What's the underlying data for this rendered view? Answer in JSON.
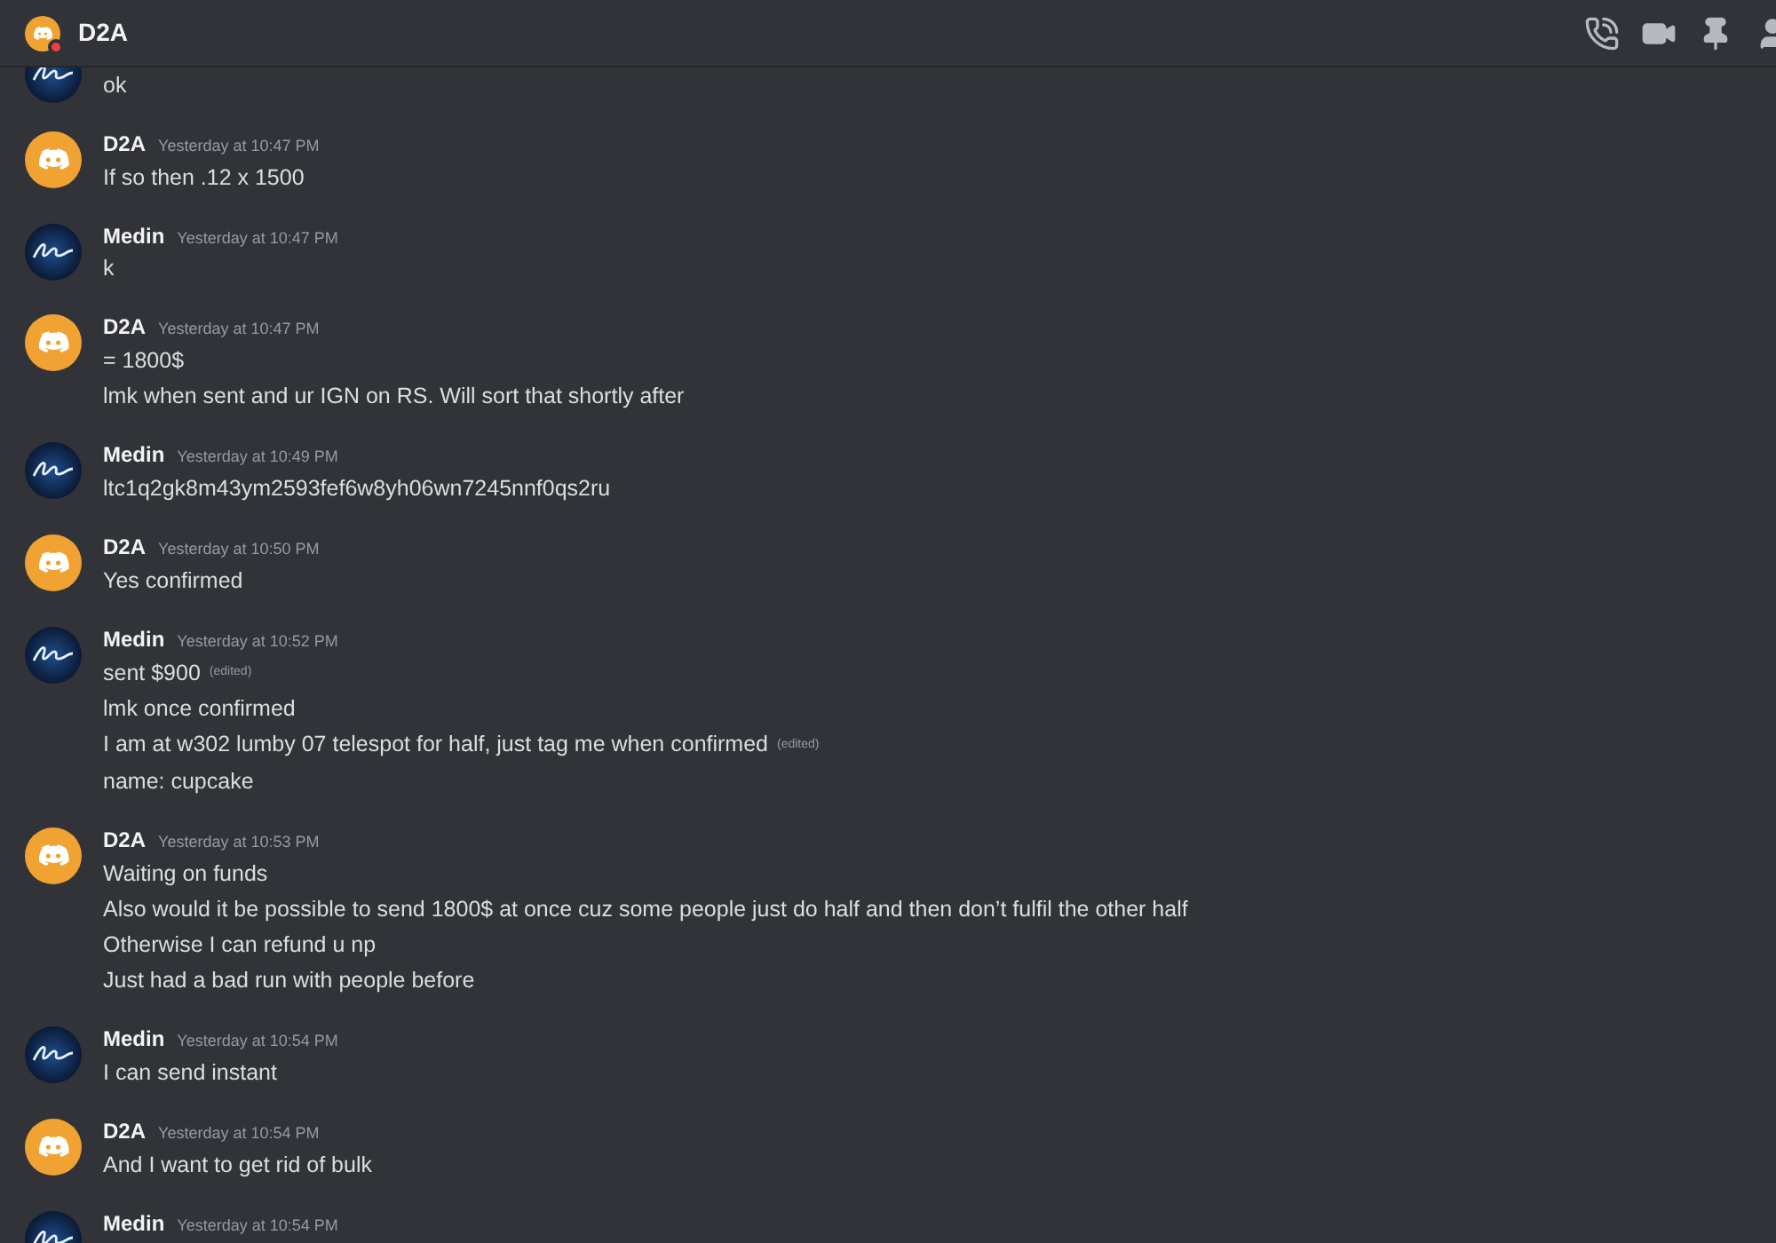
{
  "header": {
    "title": "D2A",
    "do_not_disturb": true
  },
  "messages": [
    {
      "kind": "medin",
      "lines": [
        {
          "text": "ok"
        }
      ]
    },
    {
      "author": "D2A",
      "kind": "discord",
      "time": "Yesterday at 10:47 PM",
      "lines": [
        {
          "text": "If so then .12 x 1500"
        }
      ]
    },
    {
      "author": "Medin",
      "kind": "medin",
      "time": "Yesterday at 10:47 PM",
      "lines": [
        {
          "text": "k"
        }
      ]
    },
    {
      "author": "D2A",
      "kind": "discord",
      "time": "Yesterday at 10:47 PM",
      "lines": [
        {
          "text": "= 1800$"
        },
        {
          "text": "lmk when sent and ur IGN on RS. Will sort that shortly after"
        }
      ]
    },
    {
      "author": "Medin",
      "kind": "medin",
      "time": "Yesterday at 10:49 PM",
      "lines": [
        {
          "text": "ltc1q2gk8m43ym2593fef6w8yh06wn7245nnf0qs2ru"
        }
      ]
    },
    {
      "author": "D2A",
      "kind": "discord",
      "time": "Yesterday at 10:50 PM",
      "lines": [
        {
          "text": "Yes confirmed"
        }
      ]
    },
    {
      "author": "Medin",
      "kind": "medin",
      "time": "Yesterday at 10:52 PM",
      "lines": [
        {
          "text": "sent $900",
          "edited_label": "(edited)"
        },
        {
          "text": "lmk once confirmed"
        },
        {
          "text": "I am at w302 lumby 07 telespot for half, just tag me when confirmed",
          "edited_label": "(edited)"
        },
        {
          "text": "name: cupcake"
        }
      ]
    },
    {
      "author": "D2A",
      "kind": "discord",
      "time": "Yesterday at 10:53 PM",
      "lines": [
        {
          "text": "Waiting on funds"
        },
        {
          "text": "Also would it be possible to send 1800$ at once cuz some people just do half and then don’t fulfil the other half"
        },
        {
          "text": "Otherwise I can refund u np"
        },
        {
          "text": "Just had a bad run with people before"
        }
      ]
    },
    {
      "author": "Medin",
      "kind": "medin",
      "time": "Yesterday at 10:54 PM",
      "lines": [
        {
          "text": "I can send instant"
        }
      ]
    },
    {
      "author": "D2A",
      "kind": "discord",
      "time": "Yesterday at 10:54 PM",
      "lines": [
        {
          "text": "And I want to get rid of bulk"
        }
      ]
    },
    {
      "author": "Medin",
      "kind": "medin",
      "time": "Yesterday at 10:54 PM"
    }
  ]
}
